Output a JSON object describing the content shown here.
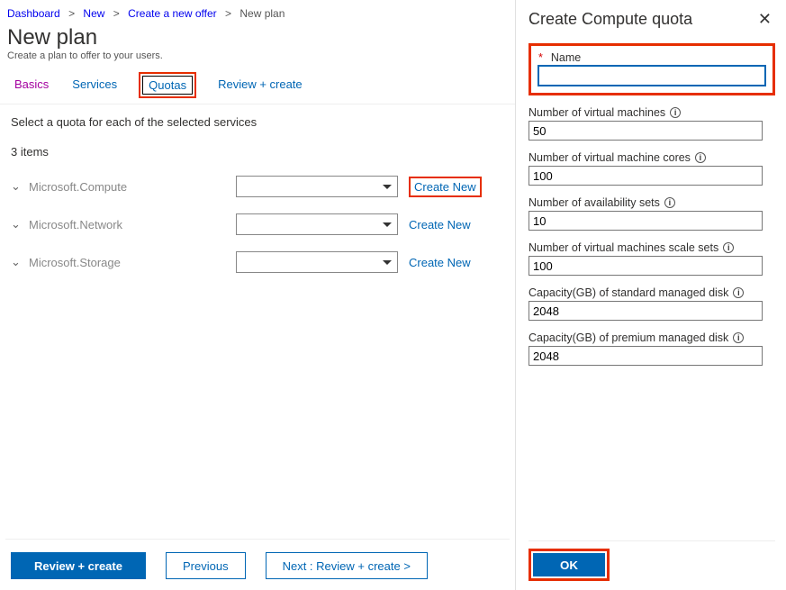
{
  "breadcrumbs": {
    "items": [
      "Dashboard",
      "New",
      "Create a new offer"
    ],
    "current": "New plan"
  },
  "page": {
    "title": "New plan",
    "subtitle": "Create a plan to offer to your users."
  },
  "tabs": {
    "basics": "Basics",
    "services": "Services",
    "quotas": "Quotas",
    "review": "Review + create"
  },
  "section": {
    "prompt": "Select a quota for each of the selected services",
    "count": "3 items"
  },
  "rows": [
    {
      "label": "Microsoft.Compute",
      "create": "Create New",
      "highlight": true
    },
    {
      "label": "Microsoft.Network",
      "create": "Create New",
      "highlight": false
    },
    {
      "label": "Microsoft.Storage",
      "create": "Create New",
      "highlight": false
    }
  ],
  "footer": {
    "review": "Review + create",
    "previous": "Previous",
    "next": "Next : Review + create >"
  },
  "panel": {
    "title": "Create Compute quota",
    "fields": {
      "name": {
        "label": "Name",
        "value": ""
      },
      "vms": {
        "label": "Number of virtual machines",
        "value": "50"
      },
      "cores": {
        "label": "Number of virtual machine cores",
        "value": "100"
      },
      "availsets": {
        "label": "Number of availability sets",
        "value": "10"
      },
      "scalesets": {
        "label": "Number of virtual machines scale sets",
        "value": "100"
      },
      "stdDisk": {
        "label": "Capacity(GB) of standard managed disk",
        "value": "2048"
      },
      "premDisk": {
        "label": "Capacity(GB) of premium managed disk",
        "value": "2048"
      }
    },
    "ok": "OK"
  }
}
